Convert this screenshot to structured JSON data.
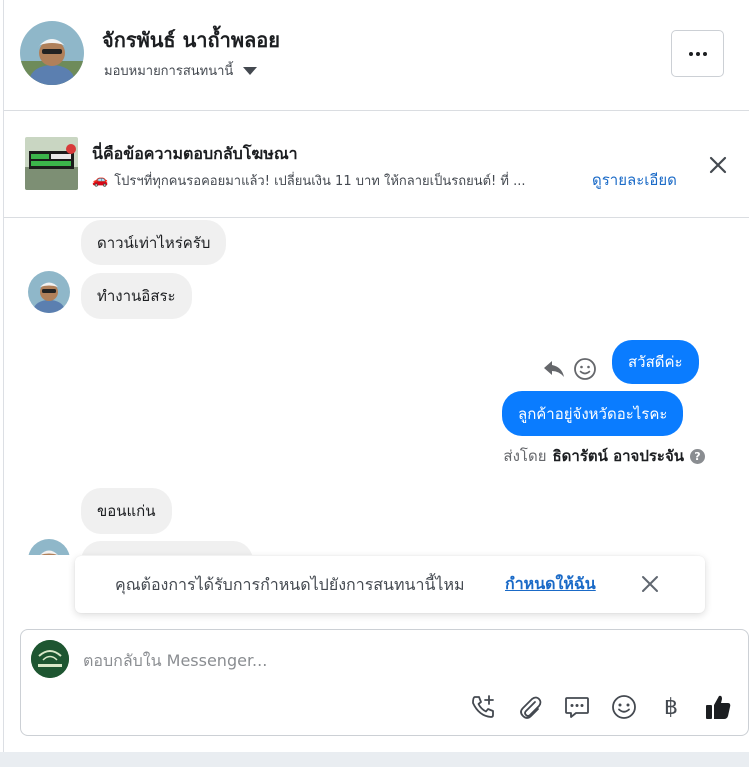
{
  "header": {
    "contact_name": "จักรพันธ์ นาถ้ำพลอย",
    "assign_label": "มอบหมายการสนทนานี้",
    "more_label": "…"
  },
  "ad": {
    "title": "นี่คือข้อความตอบกลับโฆษณา",
    "car_emoji": "🚗",
    "description": "โปรฯที่ทุกคนรอคอยมาแล้ว! เปลี่ยนเงิน 11 บาท ให้กลายเป็นรถยนต์! ที่ ...",
    "details_link": "ดูรายละเอียด"
  },
  "messages": [
    {
      "direction": "in",
      "text": "ดาวน์เท่าไหร่ครับ"
    },
    {
      "direction": "in",
      "text": "ทำงานอิสระ"
    },
    {
      "direction": "out",
      "text": "สวัสดีค่ะ"
    },
    {
      "direction": "out",
      "text": "ลูกค้าอยู่จังหวัดอะไรคะ"
    },
    {
      "direction": "in",
      "text": "ขอนแก่น"
    }
  ],
  "sent_by": {
    "prefix": "ส่งโดย",
    "agent_name": "ธิดารัตน์ อาจประจัน",
    "help_glyph": "?"
  },
  "toast": {
    "text": "คุณต้องการได้รับการกำหนดไปยังการสนทนานี้ไหม",
    "link": "กำหนดให้ฉัน"
  },
  "composer": {
    "placeholder": "ตอบกลับใน Messenger...",
    "value": "",
    "baht_glyph": "฿"
  },
  "colors": {
    "outgoing_bubble": "#0a7cff",
    "incoming_bubble": "#f0f0f0",
    "link": "#1a6ac7",
    "like": "#1c1e21"
  },
  "icons": [
    "chevron-down-icon",
    "more-icon",
    "close-icon",
    "reply-icon",
    "emoji-react-icon",
    "help-icon",
    "add-call-icon",
    "paperclip-icon",
    "saved-reply-icon",
    "emoji-icon",
    "baht-icon",
    "thumbs-up-icon"
  ]
}
